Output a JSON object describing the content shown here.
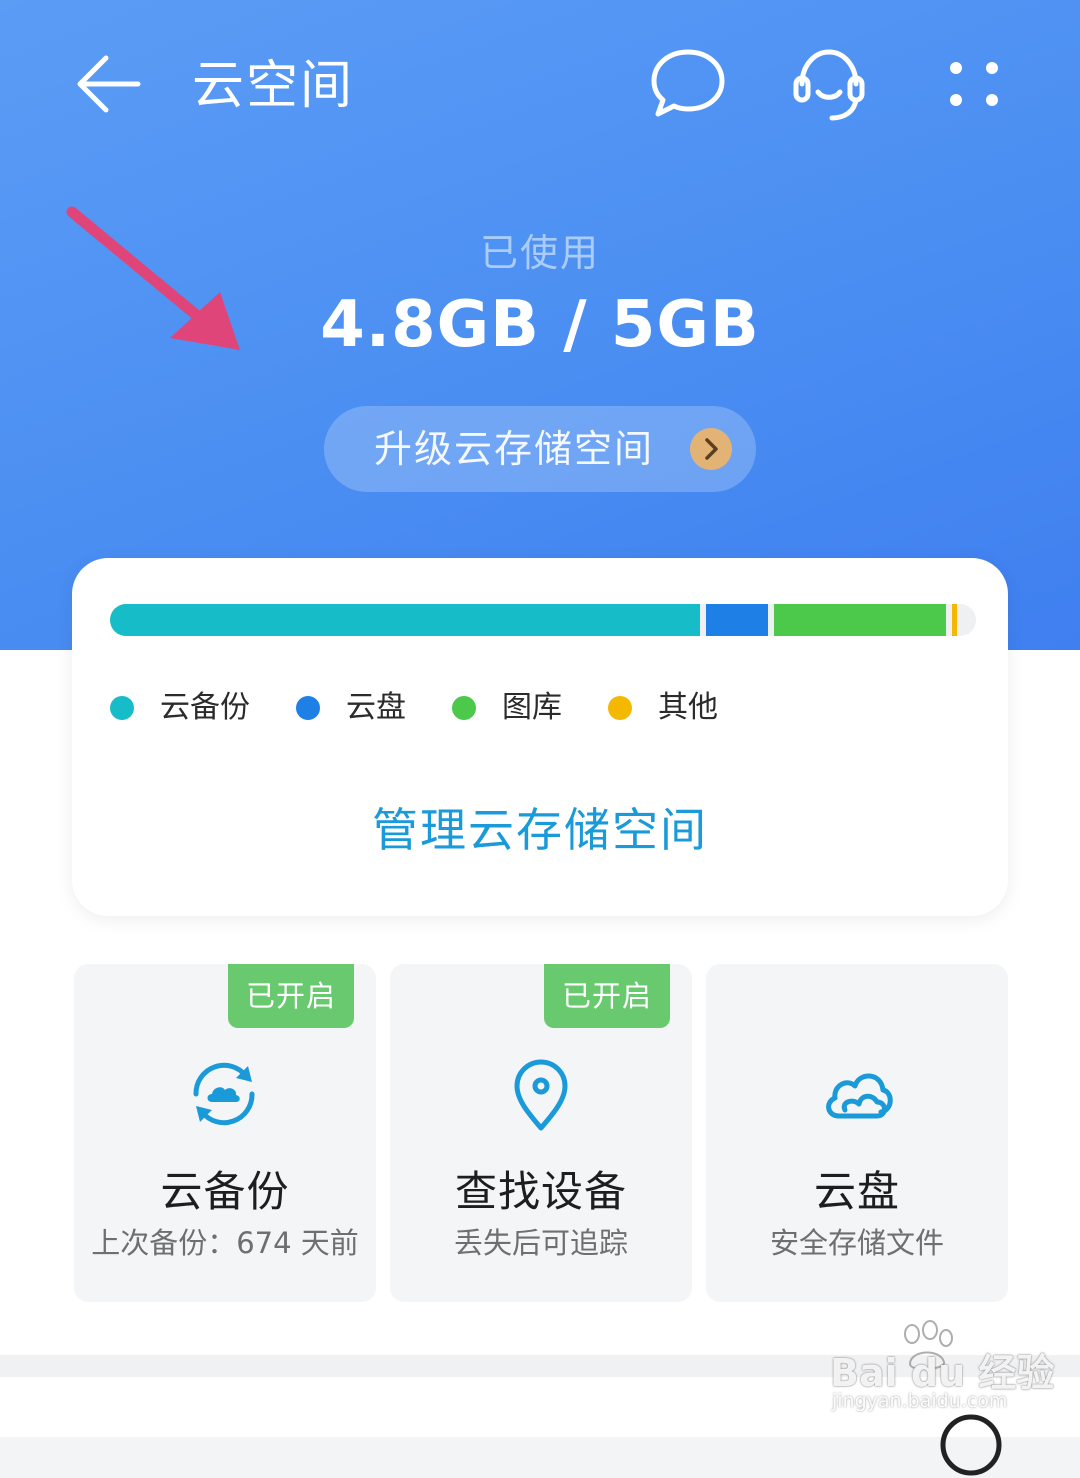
{
  "header": {
    "title": "云空间",
    "icons": [
      "back-arrow-icon",
      "message-icon",
      "customer-service-icon",
      "more-icon"
    ]
  },
  "usage": {
    "label": "已使用",
    "value": "4.8GB / 5GB",
    "used_gb": 4.8,
    "total_gb": 5
  },
  "upgrade": {
    "label": "升级云存储空间",
    "chevron_color": "#e3b375"
  },
  "storage_card": {
    "segments": [
      {
        "name": "云备份",
        "color": "#16bcc8"
      },
      {
        "name": "云盘",
        "color": "#1e7fe6"
      },
      {
        "name": "图库",
        "color": "#4cc84a"
      },
      {
        "name": "其他",
        "color": "#f5b800"
      }
    ],
    "manage_label": "管理云存储空间"
  },
  "tiles": [
    {
      "badge": "已开启",
      "title": "云备份",
      "subtitle": "上次备份：674 天前",
      "icon": "cloud-backup-icon"
    },
    {
      "badge": "已开启",
      "title": "查找设备",
      "subtitle": "丢失后可追踪",
      "icon": "location-pin-icon"
    },
    {
      "badge": "",
      "title": "云盘",
      "subtitle": "安全存储文件",
      "icon": "cloud-drive-icon"
    }
  ],
  "theme": {
    "hero_blue": "#4a8ef2",
    "accent_link": "#1a9ad8",
    "badge_green": "#69c96f",
    "annotation_arrow": "#e0457a"
  },
  "watermark": {
    "brand": "Bai du 经验",
    "url": "jingyan.baidu.com"
  }
}
